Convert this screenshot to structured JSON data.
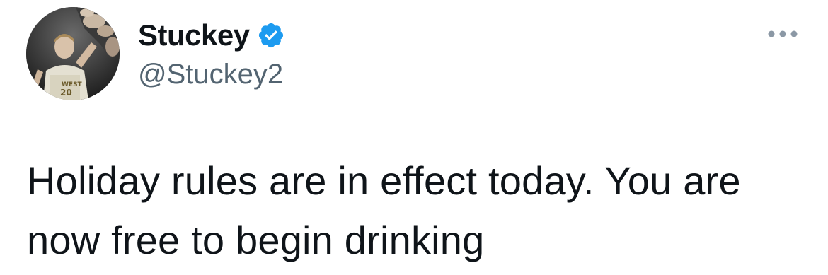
{
  "author": {
    "display_name": "Stuckey",
    "handle": "@Stuckey2",
    "verified": true,
    "avatar_icon": "profile-photo-basketball-player"
  },
  "actions": {
    "more_icon": "ellipsis-icon"
  },
  "tweet": {
    "text": "Holiday rules are in effect today. You are now free to begin drinking"
  },
  "colors": {
    "text": "#0f1419",
    "secondary_text": "#536471",
    "verified_badge": "#1d9bf0",
    "more_icon": "#8b98a5"
  }
}
